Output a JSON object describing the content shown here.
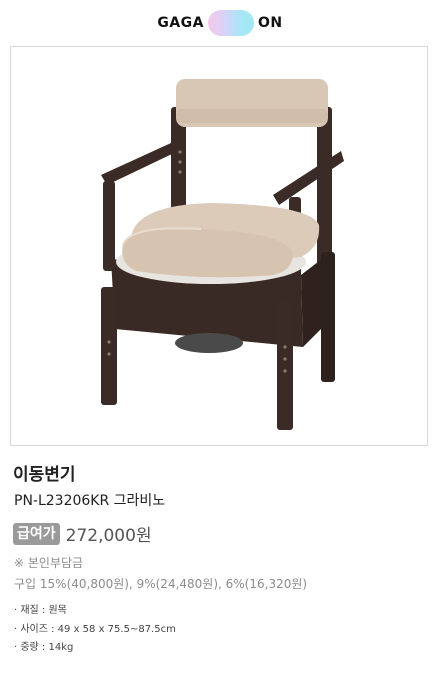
{
  "brand": {
    "left": "GAGA",
    "right": "ON"
  },
  "product": {
    "title": "이동변기",
    "model": "PN-L23206KR 그라비노",
    "badge": "급여가",
    "price": "272,000원",
    "copay_heading": "※ 본인부담금",
    "copay_detail": "구입 15%(40,800원), 9%(24,480원), 6%(16,320원)",
    "specs": [
      "· 재질 : 원목",
      "· 사이즈 : 49 x 58 x 75.5~87.5cm",
      "· 중량 : 14kg"
    ]
  },
  "colors": {
    "wood": "#3a2a25",
    "cushion": "#d9c7b6",
    "badge": "#9a9a9a",
    "muted_text": "#8c8c8c"
  }
}
